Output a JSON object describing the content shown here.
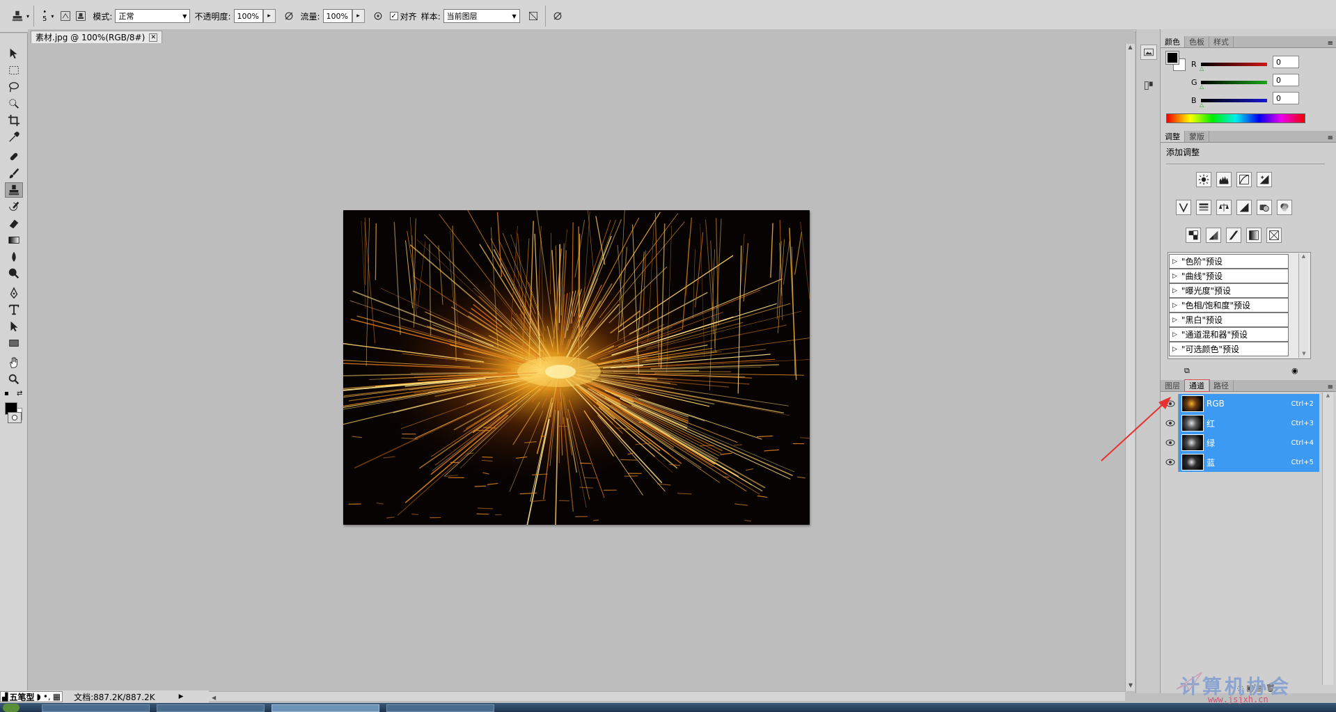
{
  "options_bar": {
    "brush_size": "5",
    "mode_label": "模式:",
    "mode_value": "正常",
    "opacity_label": "不透明度:",
    "opacity_value": "100%",
    "flow_label": "流量:",
    "flow_value": "100%",
    "aligned_label": "对齐",
    "sample_label": "样本:",
    "sample_value": "当前图层"
  },
  "document": {
    "tab_title": "素材.jpg @ 100%(RGB/8#)",
    "status_text": "文档:887.2K/887.2K"
  },
  "ime": {
    "label": "五笔型"
  },
  "color_panel": {
    "tabs": [
      "颜色",
      "色板",
      "样式"
    ],
    "r_label": "R",
    "g_label": "G",
    "b_label": "B",
    "r_value": "0",
    "g_value": "0",
    "b_value": "0",
    "colors": {
      "r": "#d01818",
      "g": "#1aa81a",
      "b": "#1818d0"
    }
  },
  "adjust_panel": {
    "tabs": [
      "调整",
      "蒙版"
    ],
    "title": "添加调整",
    "presets": [
      "\"色阶\"预设",
      "\"曲线\"预设",
      "\"曝光度\"预设",
      "\"色相/饱和度\"预设",
      "\"黑白\"预设",
      "\"通道混和器\"预设",
      "\"可选颜色\"预设"
    ]
  },
  "channels_panel": {
    "tabs": [
      "图层",
      "通道",
      "路径"
    ],
    "channels": [
      {
        "name": "RGB",
        "shortcut": "Ctrl+2"
      },
      {
        "name": "红",
        "shortcut": "Ctrl+3"
      },
      {
        "name": "绿",
        "shortcut": "Ctrl+4"
      },
      {
        "name": "蓝",
        "shortcut": "Ctrl+5"
      }
    ],
    "highlight_color": "#3d9af2"
  },
  "watermark": {
    "text": "计算机协会",
    "url": "www.jsjxh.cn"
  },
  "theme": {
    "annotation_arrow": "#e83030"
  }
}
